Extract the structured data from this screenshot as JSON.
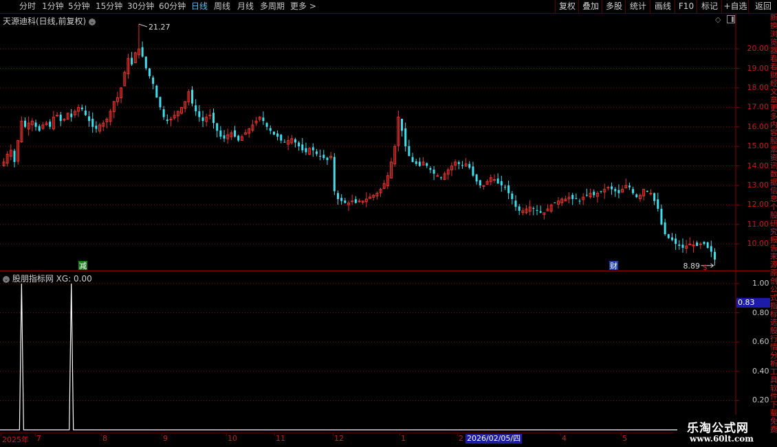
{
  "toolbar": {
    "periods": [
      {
        "label": "分时",
        "active": false
      },
      {
        "label": "1分钟",
        "active": false
      },
      {
        "label": "5分钟",
        "active": false
      },
      {
        "label": "15分钟",
        "active": false
      },
      {
        "label": "30分钟",
        "active": false
      },
      {
        "label": "60分钟",
        "active": false
      },
      {
        "label": "日线",
        "active": true
      },
      {
        "label": "周线",
        "active": false
      },
      {
        "label": "月线",
        "active": false
      },
      {
        "label": "多周期",
        "active": false
      },
      {
        "label": "更多 >",
        "active": false
      }
    ],
    "buttons": [
      "复权",
      "叠加",
      "多股",
      "统计",
      "画线",
      "F10",
      "标记",
      "+自选",
      "返回"
    ]
  },
  "main_panel": {
    "title": "天源迪科(日线,前复权)",
    "y_ticks": [
      "20.00",
      "19.00",
      "18.00",
      "17.00",
      "16.00",
      "15.00",
      "14.00",
      "13.00",
      "12.00",
      "11.00",
      "10.00"
    ],
    "max_label": "21.27",
    "min_label": "8.89",
    "markers": [
      {
        "text": "减",
        "color": "#1e7b1e"
      },
      {
        "text": "财",
        "color": "#1c3fa8"
      },
      {
        "text": "$",
        "color": "#d42020"
      }
    ]
  },
  "indicator_panel": {
    "name": "股朋指标网",
    "series_label": "XG: 0.00",
    "y_ticks": [
      "1.00",
      "0.80",
      "0.60",
      "0.40",
      "0.20"
    ],
    "current_value": "0.83"
  },
  "x_axis": {
    "labels": [
      "2025年",
      "7",
      "8",
      "9",
      "10",
      "11",
      "12",
      "1",
      "2",
      "4",
      "5"
    ],
    "highlight_date": "2026/02/05/四"
  },
  "watermark": {
    "line1": "乐淘公式网",
    "line2": "www.60lt.com"
  },
  "right_strip_glyphs": [
    "新",
    "换",
    "浏",
    "览",
    "器",
    "看",
    "看",
    "财",
    "经",
    "文",
    "章",
    "更",
    "多",
    "内",
    "容",
    "股",
    "票",
    "资",
    "讯",
    "数",
    "据",
    "信",
    "息",
    "个",
    "股",
    "研",
    "究",
    "报",
    "告",
    "来",
    "源",
    "原",
    "创",
    "公",
    "式",
    "指",
    "标",
    "选",
    "股",
    "行",
    "情",
    "分",
    "析",
    "工",
    "具",
    "软",
    "件",
    "下",
    "载",
    "免",
    "费"
  ],
  "colors": {
    "up": "#e8322e",
    "down": "#3ce0f0",
    "grid": "#7a1010",
    "frame": "#8a0000",
    "indicator_line": "#ffffff"
  },
  "chart_data": {
    "type": "candlestick",
    "title": "天源迪科(日线,前复权)",
    "ylim": [
      8.6,
      21.8
    ],
    "price_path": [
      14.2,
      14.6,
      14.8,
      14.2,
      15.3,
      16.3,
      16.0,
      16.2,
      16.3,
      16.0,
      15.8,
      16.1,
      16.2,
      16.0,
      16.5,
      16.6,
      16.3,
      16.4,
      16.7,
      16.5,
      16.8,
      17.0,
      16.9,
      16.6,
      16.3,
      16.0,
      15.9,
      16.1,
      16.2,
      16.4,
      16.8,
      17.3,
      17.5,
      18.0,
      18.8,
      19.5,
      19.2,
      19.8,
      20.0,
      19.6,
      19.0,
      18.6,
      18.2,
      17.5,
      17.0,
      16.5,
      16.3,
      16.4,
      16.6,
      16.8,
      17.0,
      17.3,
      17.8,
      17.2,
      16.8,
      16.5,
      16.3,
      16.5,
      16.6,
      16.2,
      15.8,
      15.5,
      15.4,
      15.6,
      15.7,
      15.5,
      15.3,
      15.5,
      15.7,
      15.9,
      16.1,
      16.3,
      16.5,
      16.3,
      16.0,
      15.8,
      15.6,
      15.5,
      15.3,
      15.2,
      15.3,
      15.4,
      15.2,
      15.0,
      14.8,
      14.7,
      14.9,
      14.8,
      14.6,
      14.5,
      14.4,
      14.3,
      14.5,
      12.7,
      12.3,
      12.2,
      12.1,
      12.1,
      12.2,
      12.1,
      12.2,
      12.2,
      12.3,
      12.4,
      12.5,
      12.6,
      12.8,
      13.1,
      13.5,
      14.2,
      15.0,
      16.5,
      15.8,
      15.0,
      14.5,
      14.2,
      14.1,
      14.0,
      14.2,
      14.0,
      13.8,
      13.6,
      13.5,
      13.4,
      13.6,
      13.8,
      14.0,
      14.2,
      14.1,
      14.0,
      14.1,
      13.9,
      13.5,
      13.2,
      13.0,
      13.0,
      13.2,
      13.4,
      13.3,
      13.1,
      13.0,
      12.9,
      12.6,
      12.3,
      11.9,
      11.7,
      11.7,
      11.8,
      11.9,
      11.8,
      11.7,
      11.6,
      11.6,
      11.8,
      12.0,
      12.1,
      12.2,
      12.3,
      12.3,
      12.4,
      12.3,
      12.3,
      12.2,
      12.4,
      12.5,
      12.6,
      12.5,
      12.6,
      12.7,
      12.8,
      12.9,
      12.8,
      12.7,
      12.6,
      12.8,
      13.0,
      12.9,
      12.6,
      12.4,
      12.5,
      12.8,
      12.7,
      12.6,
      12.2,
      11.8,
      11.0,
      10.5,
      10.3,
      10.2,
      10.0,
      9.9,
      9.8,
      9.9,
      10.0,
      9.95,
      9.9,
      10.0,
      10.0,
      9.8,
      9.6,
      9.2
    ],
    "high": 21.27,
    "low": 8.89
  },
  "indicator_data": {
    "type": "line",
    "name": "XG",
    "baseline": 0,
    "spikes": [
      {
        "bar_index": 5,
        "value": 1.0
      },
      {
        "bar_index": 19,
        "value": 1.0
      }
    ],
    "ylim": [
      0,
      1.1
    ]
  }
}
